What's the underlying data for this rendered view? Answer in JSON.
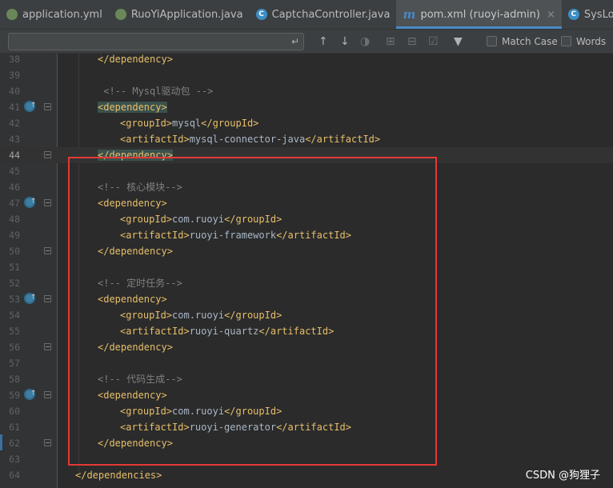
{
  "tabs": [
    {
      "label": "application.yml",
      "icon": "leaf-yml-icon",
      "active": false,
      "close": ""
    },
    {
      "label": "RuoYiApplication.java",
      "icon": "spring-class-icon",
      "active": false,
      "close": ""
    },
    {
      "label": "CaptchaController.java",
      "icon": "class-icon",
      "active": false,
      "close": ""
    },
    {
      "label": "pom.xml (ruoyi-admin)",
      "icon": "maven-icon",
      "active": true,
      "close": "×"
    },
    {
      "label": "SysLoginC",
      "icon": "class-icon",
      "active": false,
      "close": ""
    }
  ],
  "search": {
    "value": "",
    "match_case_label": "Match Case",
    "words_label": "Words"
  },
  "lines": [
    {
      "n": "38",
      "indent": 1,
      "parts": [
        [
          "tag",
          "</dependency>"
        ]
      ]
    },
    {
      "n": "39",
      "indent": 0,
      "parts": []
    },
    {
      "n": "40",
      "indent": 1,
      "parts": [
        [
          "cmt",
          " <!-- Mysql驱动包 -->"
        ]
      ]
    },
    {
      "n": "41",
      "indent": 1,
      "parts": [
        [
          "tag-hl",
          "<dependency>"
        ]
      ],
      "gutter_icon": true,
      "fold": true
    },
    {
      "n": "42",
      "indent": 2,
      "parts": [
        [
          "tag",
          "<groupId>"
        ],
        [
          "txt",
          "mysql"
        ],
        [
          "tag",
          "</groupId>"
        ]
      ]
    },
    {
      "n": "43",
      "indent": 2,
      "parts": [
        [
          "tag",
          "<artifactId>"
        ],
        [
          "txt",
          "mysql-connector-java"
        ],
        [
          "tag",
          "</artifactId>"
        ]
      ]
    },
    {
      "n": "44",
      "indent": 1,
      "parts": [
        [
          "tag-hl",
          "</dependency>"
        ]
      ],
      "current": true,
      "fold": true
    },
    {
      "n": "45",
      "indent": 0,
      "parts": []
    },
    {
      "n": "46",
      "indent": 1,
      "parts": [
        [
          "cmt",
          "<!-- 核心模块-->"
        ]
      ]
    },
    {
      "n": "47",
      "indent": 1,
      "parts": [
        [
          "tag",
          "<dependency>"
        ]
      ],
      "gutter_icon": true,
      "fold": true
    },
    {
      "n": "48",
      "indent": 2,
      "parts": [
        [
          "tag",
          "<groupId>"
        ],
        [
          "txt",
          "com.ruoyi"
        ],
        [
          "tag",
          "</groupId>"
        ]
      ]
    },
    {
      "n": "49",
      "indent": 2,
      "parts": [
        [
          "tag",
          "<artifactId>"
        ],
        [
          "txt",
          "ruoyi-framework"
        ],
        [
          "tag",
          "</artifactId>"
        ]
      ]
    },
    {
      "n": "50",
      "indent": 1,
      "parts": [
        [
          "tag",
          "</dependency>"
        ]
      ],
      "fold": true
    },
    {
      "n": "51",
      "indent": 0,
      "parts": []
    },
    {
      "n": "52",
      "indent": 1,
      "parts": [
        [
          "cmt",
          "<!-- 定时任务-->"
        ]
      ]
    },
    {
      "n": "53",
      "indent": 1,
      "parts": [
        [
          "tag",
          "<dependency>"
        ]
      ],
      "gutter_icon": true,
      "fold": true
    },
    {
      "n": "54",
      "indent": 2,
      "parts": [
        [
          "tag",
          "<groupId>"
        ],
        [
          "txt",
          "com.ruoyi"
        ],
        [
          "tag",
          "</groupId>"
        ]
      ]
    },
    {
      "n": "55",
      "indent": 2,
      "parts": [
        [
          "tag",
          "<artifactId>"
        ],
        [
          "txt",
          "ruoyi-quartz"
        ],
        [
          "tag",
          "</artifactId>"
        ]
      ]
    },
    {
      "n": "56",
      "indent": 1,
      "parts": [
        [
          "tag",
          "</dependency>"
        ]
      ],
      "fold": true
    },
    {
      "n": "57",
      "indent": 0,
      "parts": []
    },
    {
      "n": "58",
      "indent": 1,
      "parts": [
        [
          "cmt",
          "<!-- 代码生成-->"
        ]
      ]
    },
    {
      "n": "59",
      "indent": 1,
      "parts": [
        [
          "tag",
          "<dependency>"
        ]
      ],
      "gutter_icon": true,
      "fold": true
    },
    {
      "n": "60",
      "indent": 2,
      "parts": [
        [
          "tag",
          "<groupId>"
        ],
        [
          "txt",
          "com.ruoyi"
        ],
        [
          "tag",
          "</groupId>"
        ]
      ]
    },
    {
      "n": "61",
      "indent": 2,
      "parts": [
        [
          "tag",
          "<artifactId>"
        ],
        [
          "txt",
          "ruoyi-generator"
        ],
        [
          "tag",
          "</artifactId>"
        ]
      ]
    },
    {
      "n": "62",
      "indent": 1,
      "parts": [
        [
          "tag",
          "</dependency>"
        ]
      ],
      "fold": true
    },
    {
      "n": "63",
      "indent": 0,
      "parts": []
    },
    {
      "n": "64",
      "indent": 0,
      "parts": [
        [
          "tag",
          "</dependencies>"
        ]
      ]
    }
  ],
  "watermark": "CSDN @狗狸子",
  "colors": {
    "tag": "#e8bf6a",
    "text": "#a9b7c6",
    "comment": "#808080",
    "annotation_box": "#e53935"
  }
}
